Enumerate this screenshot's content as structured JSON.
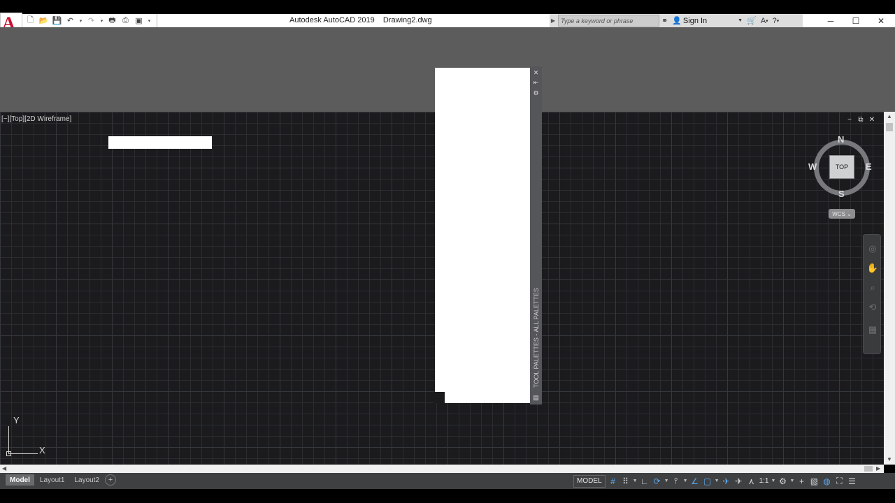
{
  "window": {
    "app_logo": "A",
    "title": "Autodesk AutoCAD 2019    Drawing2.dwg",
    "controls": {
      "minimize": "─",
      "maximize": "☐",
      "close": "✕"
    }
  },
  "qat": {
    "new": "🗋",
    "open": "📂",
    "save": "💾",
    "undo": "↶",
    "redo": "↷",
    "plot": "🖶",
    "publish": "⎙",
    "sheetset": "▣",
    "customize": "▾"
  },
  "search": {
    "placeholder": "Type a keyword or phrase",
    "signin_label": "Sign In"
  },
  "viewport": {
    "label": "[−][Top][2D Wireframe]",
    "controls": {
      "minimize": "−",
      "restore": "⧉",
      "close": "✕"
    }
  },
  "viewcube": {
    "face": "TOP",
    "north": "N",
    "south": "S",
    "east": "E",
    "west": "W",
    "wcs": "WCS ⌄"
  },
  "ucs": {
    "x": "X",
    "y": "Y"
  },
  "palette": {
    "label": "TOOL PALETTES - ALL PALETTES",
    "close": "✕",
    "autohide": "⇤",
    "properties": "⚙",
    "menu": "▤"
  },
  "layouts": {
    "tabs": [
      "Model",
      "Layout1",
      "Layout2"
    ],
    "add": "+"
  },
  "status": {
    "model": "MODEL",
    "scale": "1:1"
  },
  "accent_colors": {
    "ribbon": "#5c5c5c",
    "canvas": "#1b1b1e",
    "active_toggle": "#5aa7ef",
    "logo_red": "#c8102e"
  }
}
